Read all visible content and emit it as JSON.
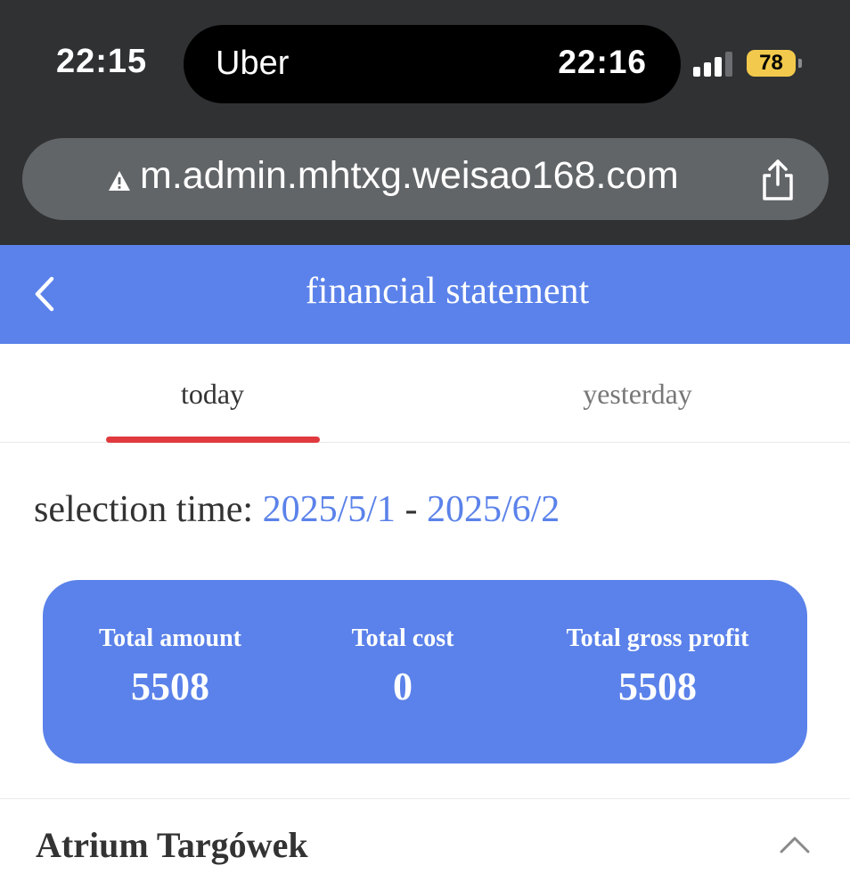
{
  "status_bar": {
    "time": "22:15",
    "island_app": "Uber",
    "island_time": "22:16",
    "signal_bars_active": 3,
    "signal_bars_total": 4,
    "battery": "78",
    "battery_color": "#f2c94c"
  },
  "browser": {
    "url": "m.admin.mhtxg.weisao168.com",
    "security_icon": "warning-icon",
    "share_icon": "share-icon"
  },
  "header": {
    "title": "financial statement",
    "back_icon": "chevron-left-icon",
    "background": "#5b82ea"
  },
  "tabs": [
    {
      "label": "today",
      "active": true
    },
    {
      "label": "yesterday",
      "active": false
    }
  ],
  "selection": {
    "label": "selection time:",
    "start": "2025/5/1",
    "separator": "-",
    "end": "2025/6/2"
  },
  "summary": {
    "total_amount_label": "Total amount",
    "total_amount": "5508",
    "total_cost_label": "Total cost",
    "total_cost": "0",
    "total_gross_profit_label": "Total gross profit",
    "total_gross_profit": "5508"
  },
  "store": {
    "name": "Atrium Targówek",
    "toggle_icon": "chevron-up-icon"
  },
  "colors": {
    "accent": "#5b82ea",
    "tab_indicator": "#e03a3e"
  }
}
